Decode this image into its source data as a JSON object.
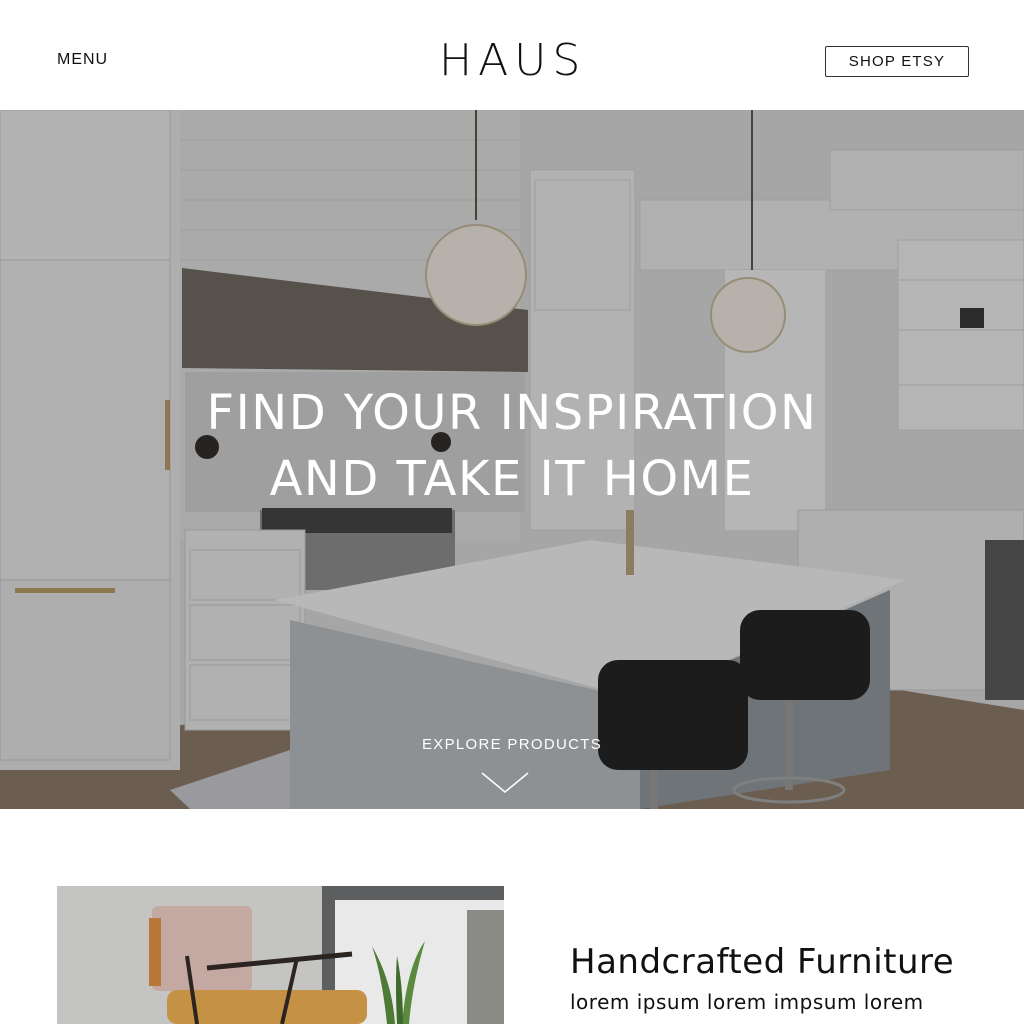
{
  "header": {
    "menu_label": "MENU",
    "logo_text": "HAUS",
    "shop_button_label": "SHOP ETSY"
  },
  "hero": {
    "title_line1": "FIND YOUR INSPIRATION",
    "title_line2": "AND TAKE IT HOME",
    "explore_label": "EXPLORE PRODUCTS",
    "image_description_icon": "kitchen-photo"
  },
  "feature": {
    "title": "Handcrafted Furniture",
    "body": "lorem ipsum lorem impsum lorem",
    "image_icon": "chair-photo"
  },
  "colors": {
    "text": "#111111",
    "background": "#ffffff",
    "hero_text": "#ffffff"
  }
}
